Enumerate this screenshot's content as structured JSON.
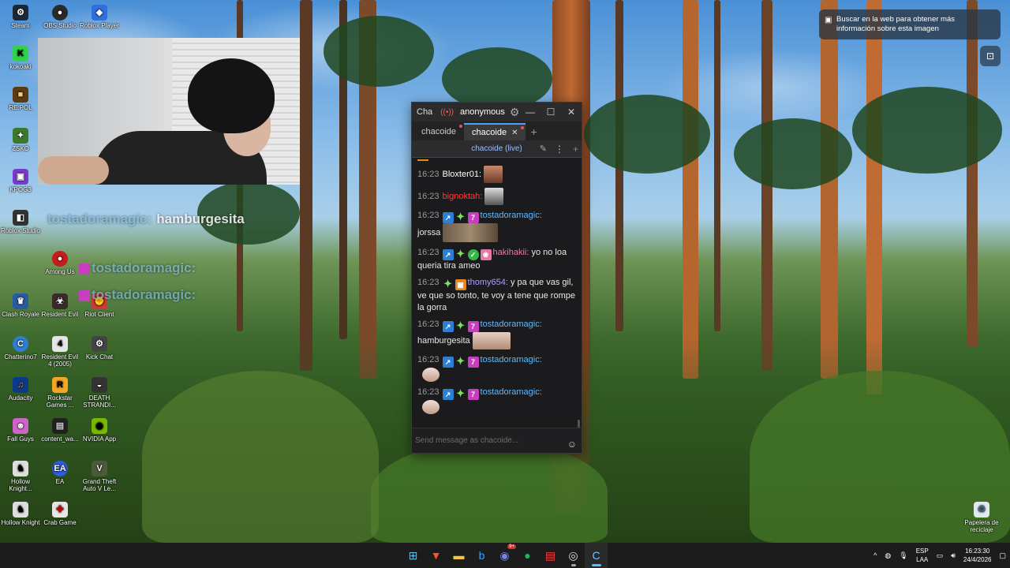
{
  "desktop_icons": [
    {
      "label": "Steam",
      "icon": "steam-icon",
      "color": "#1b2838"
    },
    {
      "label": "OBS Studio",
      "icon": "obs-icon",
      "color": "#2a2a2a"
    },
    {
      "label": "Roblox Player",
      "icon": "roblox-icon",
      "color": "#2f6fe0"
    },
    {
      "label": "kokoaki",
      "icon": "kick-green-icon",
      "color": "#2fd24a"
    },
    {
      "label": "RE:POL",
      "icon": "app-icon",
      "color": "#5a3b12"
    },
    {
      "label": "ZSKO",
      "icon": "app-icon",
      "color": "#3a7a2a"
    },
    {
      "label": "KPOG3",
      "icon": "app-icon",
      "color": "#7a3ad0"
    },
    {
      "label": "Roblox Studio",
      "icon": "roblox-studio-icon",
      "color": "#333333"
    },
    {
      "label": "Among Us",
      "icon": "among-us-icon",
      "color": "#c31d1d"
    },
    {
      "label": "Clash Royale",
      "icon": "clash-icon",
      "color": "#2a5aa0"
    },
    {
      "label": "Resident Evil",
      "icon": "re-icon",
      "color": "#3a2a2a"
    },
    {
      "label": "Riot Client",
      "icon": "riot-icon",
      "color": "#d13639"
    },
    {
      "label": "Chatterino7",
      "icon": "chatterino-icon",
      "color": "#2d7fd3"
    },
    {
      "label": "Resident Evil 4 (2005)",
      "icon": "re4-icon",
      "color": "#e6e6e6"
    },
    {
      "label": "Kick Chat",
      "icon": "kick-chat-icon",
      "color": "#444444"
    },
    {
      "label": "Audacity",
      "icon": "audacity-icon",
      "color": "#0a3a8a"
    },
    {
      "label": "Rockstar Games ...",
      "icon": "rockstar-icon",
      "color": "#f5a623"
    },
    {
      "label": "DEATH STRANDI...",
      "icon": "ds-icon",
      "color": "#333333"
    },
    {
      "label": "Fall Guys",
      "icon": "fall-guys-icon",
      "color": "#d062c8"
    },
    {
      "label": "content_wa...",
      "icon": "folder-icon",
      "color": "#222222"
    },
    {
      "label": "NVIDIA App",
      "icon": "nvidia-icon",
      "color": "#76b900"
    },
    {
      "label": "Hollow Knight...",
      "icon": "hollow-knight-icon",
      "color": "#dddddd"
    },
    {
      "label": "EA",
      "icon": "ea-icon",
      "color": "#2a5be0"
    },
    {
      "label": "Grand Theft Auto V Le...",
      "icon": "gta-icon",
      "color": "#4a5a3a"
    },
    {
      "label": "Hollow Knight",
      "icon": "hollow-knight-icon",
      "color": "#dddddd"
    },
    {
      "label": "Crab Game",
      "icon": "crab-game-icon",
      "color": "#e6e6e6"
    },
    {
      "label": "Papelera de reciclaje",
      "icon": "recycle-bin-icon",
      "color": "#dfe8ee"
    }
  ],
  "overlay": {
    "line1_user": "tostadoramagic:",
    "line1_msg": "hamburgesita",
    "line2_user": "tostadoramagic:",
    "line3_user": "tostadoramagic:"
  },
  "chat_window": {
    "title": "Cha",
    "status_user": "anonymous",
    "tabs": [
      {
        "label": "chacoide",
        "active": false
      },
      {
        "label": "chacoide",
        "active": true
      }
    ],
    "channel_header": "chacoide (live)",
    "messages": [
      {
        "time": "16:23",
        "user": "Bloxter01:",
        "user_color": "#ffffff",
        "text": "",
        "emote": true
      },
      {
        "time": "16:23",
        "user": "bignoktah:",
        "user_color": "#ff3b3b",
        "text": "",
        "emote": true
      },
      {
        "time": "16:23",
        "user": "tostadoramagic:",
        "user_color": "#5fb9ff",
        "text": "jorssa",
        "emote": true
      },
      {
        "time": "16:23",
        "user": "hakihakii:",
        "user_color": "#ff6fa8",
        "text": "yo no loa queria tira ameo"
      },
      {
        "time": "16:23",
        "user": "thomy654:",
        "user_color": "#b39dff",
        "text": "y pa que vas gil, ve que so tonto, te voy a tene que rompe la gorra"
      },
      {
        "time": "16:23",
        "user": "tostadoramagic:",
        "user_color": "#5fb9ff",
        "text": "hamburgesita",
        "emote": true
      },
      {
        "time": "16:23",
        "user": "tostadoramagic:",
        "user_color": "#5fb9ff",
        "text": "",
        "emote": true
      },
      {
        "time": "16:23",
        "user": "tostadoramagic:",
        "user_color": "#5fb9ff",
        "text": "",
        "emote": true
      }
    ],
    "input_placeholder": "Send message as chacoide..."
  },
  "lens": {
    "text": "Buscar en la web para obtener más información sobre esta imagen"
  },
  "taskbar": {
    "lang_top": "ESP",
    "lang_bottom": "LAA",
    "time": "16:23:30",
    "date": "24/4/2026",
    "badge_count": "9+"
  }
}
